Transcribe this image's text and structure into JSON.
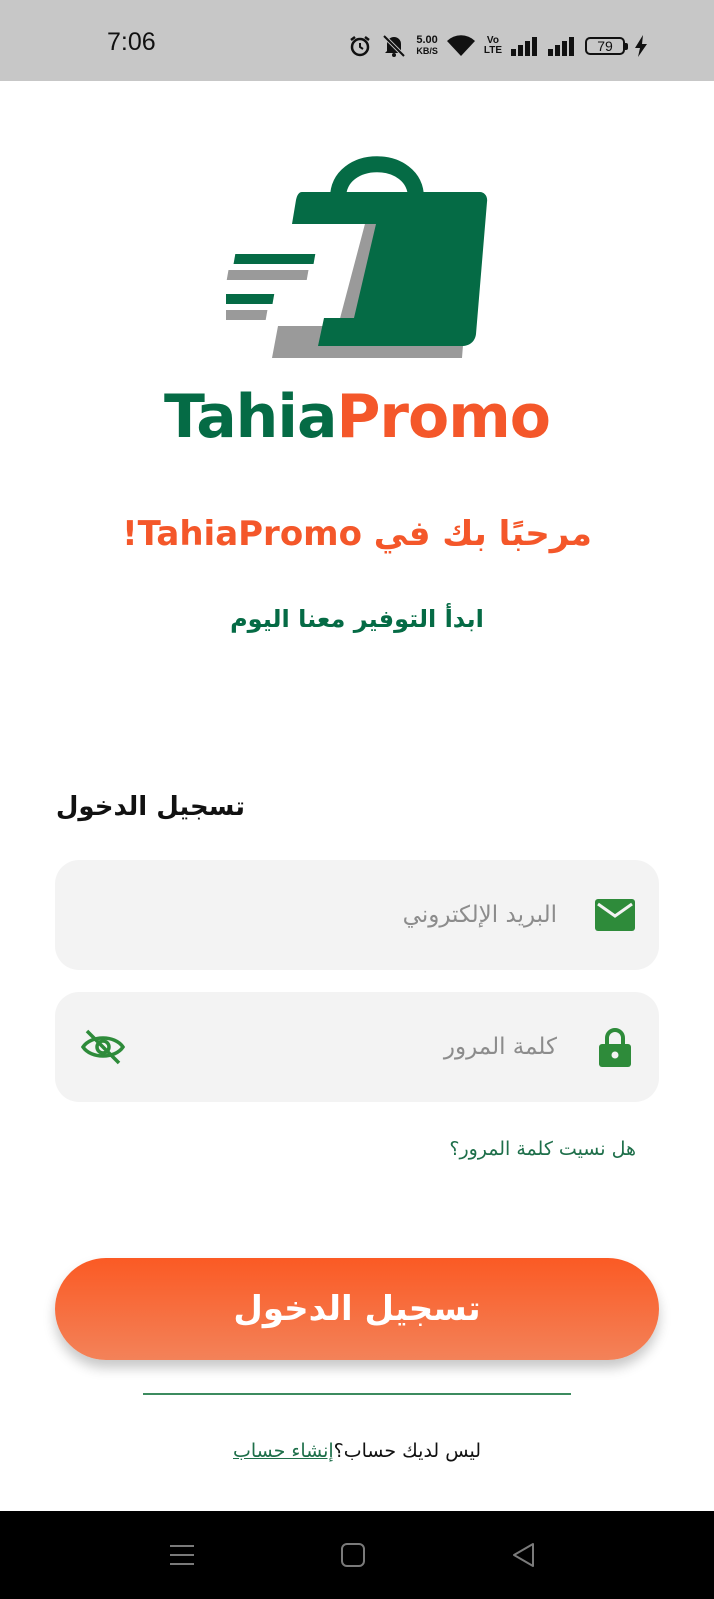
{
  "status_bar": {
    "time": "7:06",
    "net_speed_value": "5.00",
    "net_speed_unit": "KB/S",
    "volte_line1": "Vo",
    "volte_line2": "LTE",
    "battery": "79",
    "icons": [
      "alarm-icon",
      "mute-icon",
      "wifi-icon",
      "signal-icon",
      "signal-icon",
      "battery-icon",
      "charging-icon"
    ]
  },
  "logo": {
    "part1": "Tahia",
    "part2": "Promo"
  },
  "welcome_title": "مرحبًا بك في TahiaPromo!",
  "subtitle": "ابدأ التوفير معنا اليوم",
  "login_section": {
    "title": "تسجيل الدخول",
    "email_placeholder": "البريد الإلكتروني",
    "password_placeholder": "كلمة المرور",
    "forgot_password": "هل نسيت كلمة المرور؟",
    "login_button": "تسجيل الدخول",
    "no_account_text": "ليس لديك حساب؟",
    "create_account_link": "إنشاء حساب"
  },
  "colors": {
    "brand_green": "#056b45",
    "brand_orange": "#f4572a",
    "field_bg": "#f3f3f3"
  }
}
